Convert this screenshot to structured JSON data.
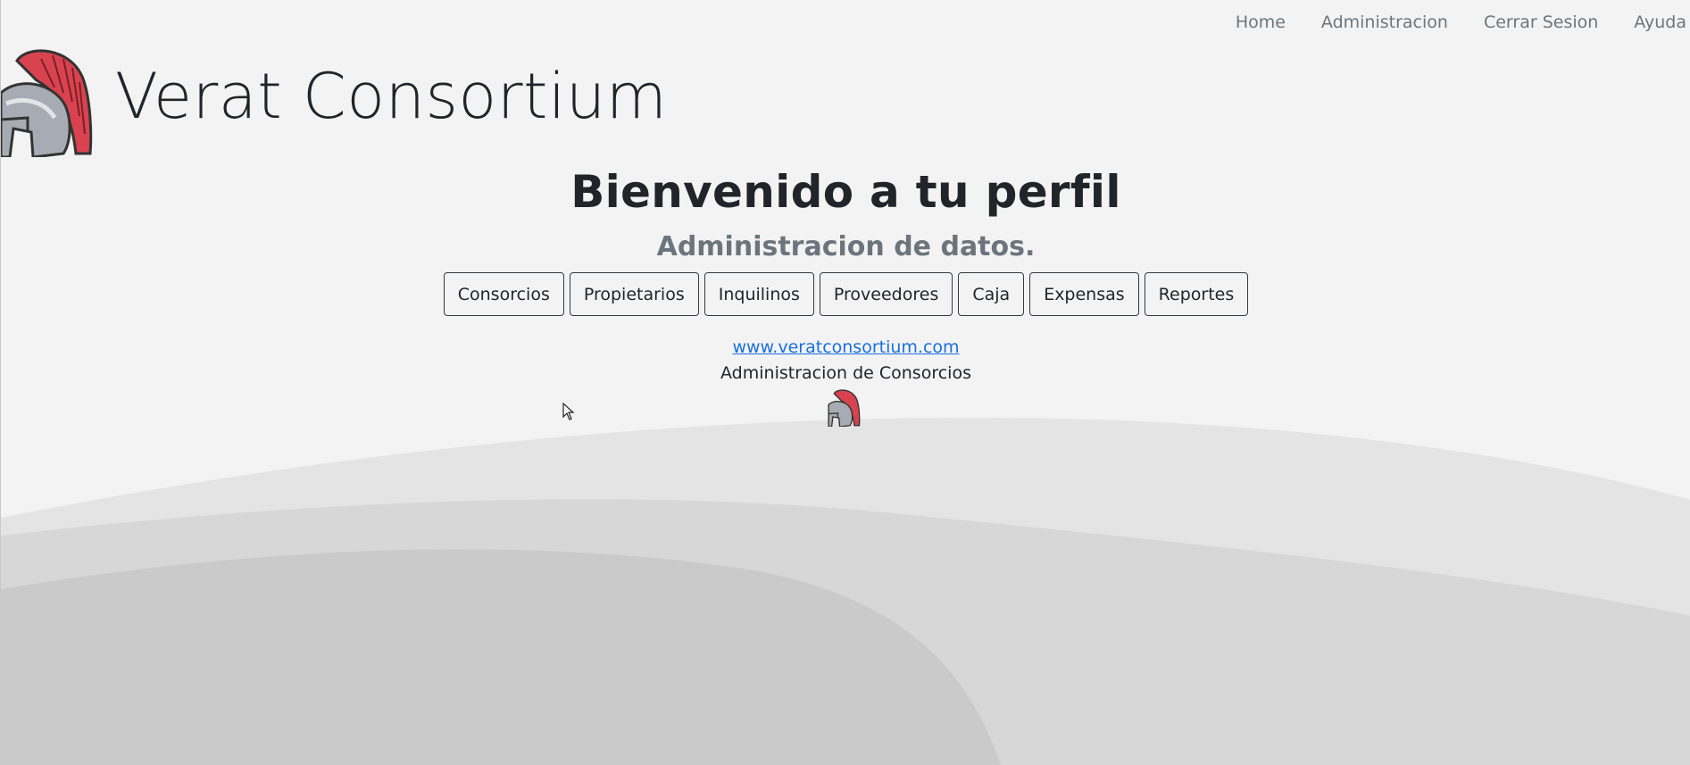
{
  "brand": {
    "title": "Verat Consortium",
    "logo_icon": "spartan-helmet-icon"
  },
  "nav": {
    "items": [
      {
        "label": "Home"
      },
      {
        "label": "Administracion"
      },
      {
        "label": "Cerrar Sesion"
      },
      {
        "label": "Ayuda"
      }
    ]
  },
  "main": {
    "heading": "Bienvenido a tu perfil",
    "subheading": "Administracion de datos.",
    "buttons": [
      {
        "label": "Consorcios"
      },
      {
        "label": "Propietarios"
      },
      {
        "label": "Inquilinos"
      },
      {
        "label": "Proveedores"
      },
      {
        "label": "Caja"
      },
      {
        "label": "Expensas"
      },
      {
        "label": "Reportes"
      }
    ]
  },
  "footer": {
    "link_text": "www.veratconsortium.com",
    "description": "Administracion de Consorcios",
    "logo_icon": "spartan-helmet-icon"
  },
  "colors": {
    "background": "#f3f3f3",
    "link": "#1a6fe0",
    "muted_text": "#6c757d",
    "helmet_plume": "#d9434f",
    "helmet_metal": "#a7acb4"
  }
}
